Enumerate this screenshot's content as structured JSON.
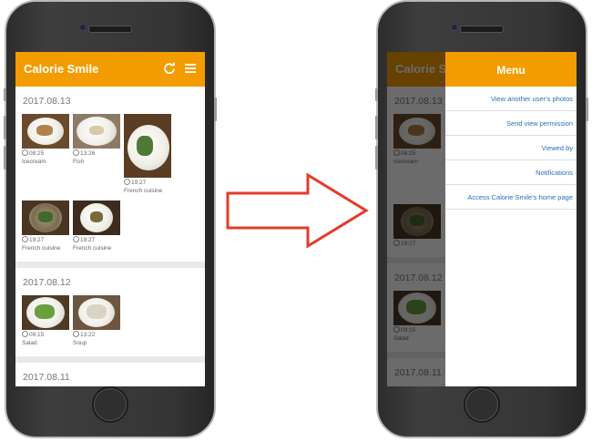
{
  "app": {
    "title": "Calorie Smile"
  },
  "colors": {
    "accent": "#f39c00",
    "arrow": "#e53c2a",
    "link": "#2a6ebb"
  },
  "icons": {
    "refresh": "refresh-icon",
    "menu": "hamburger-menu-icon",
    "arrow": "right-arrow"
  },
  "feed": [
    {
      "date": "2017.08.13",
      "items": [
        {
          "time": "08:25",
          "label": "Icecream"
        },
        {
          "time": "13:26",
          "label": "Fish"
        },
        {
          "time": "19:27",
          "label": "French cuisine"
        },
        {
          "time": "19:27",
          "label": "French cuisine"
        },
        {
          "time": "19:27",
          "label": "French cuisine"
        }
      ]
    },
    {
      "date": "2017.08.12",
      "items": [
        {
          "time": "09:15",
          "label": "Salad"
        },
        {
          "time": "13:22",
          "label": "Soup"
        }
      ]
    },
    {
      "date": "2017.08.11",
      "items": []
    }
  ],
  "menu": {
    "title": "Menu",
    "items": [
      "View another user's photos",
      "Send view permission",
      "Viewed by",
      "Notifications",
      "Access Calorie Smile's home page"
    ]
  }
}
